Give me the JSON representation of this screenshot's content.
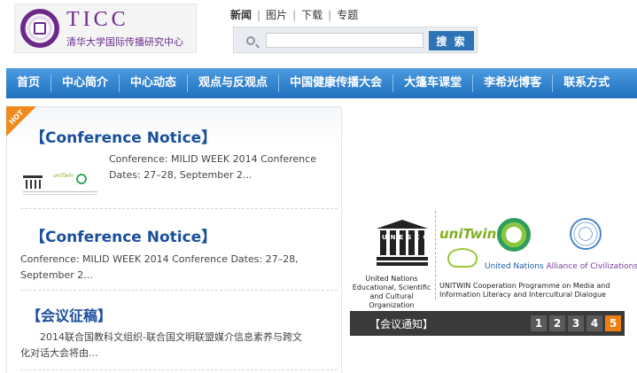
{
  "header": {
    "logo_title": "TICC",
    "logo_subtitle": "清华大学国际传播研究中心",
    "top_links": [
      "新闻",
      "图片",
      "下载",
      "专题"
    ],
    "search": {
      "value": "",
      "placeholder": "",
      "button_label": "搜 索"
    }
  },
  "nav": {
    "items": [
      "首页",
      "中心简介",
      "中心动态",
      "观点与反观点",
      "中国健康传播大会",
      "大篷车课堂",
      "李希光博客",
      "联系方式"
    ]
  },
  "hot_badge": "HOT",
  "news": [
    {
      "title": "【Conference Notice】",
      "excerpt_line1": "Conference: MILID WEEK 2014 Conference",
      "excerpt_line2": "Dates: 27–28,  September 2..."
    },
    {
      "title": "【Conference Notice】",
      "excerpt_line1": "Conference: MILID WEEK 2014 Conference Dates: 27–28,",
      "excerpt_line2": "September 2..."
    },
    {
      "title": "【会议征稿】",
      "excerpt_line1": "2014联合国教科文组织-联合国文明联盟媒介信息素养与跨文",
      "excerpt_line2": "化对话大会将由..."
    }
  ],
  "thumb": {
    "unitwin": "uniTwin"
  },
  "slider": {
    "unesco_letters": "UNESCO",
    "unesco_caption": "United Nations Educational, Scientific and Cultural Organization",
    "unitwin_logo": "uniTwin",
    "unitwin_caption": "UNITWIN Cooperation Programme on Media and Information Literacy and Intercultural Dialogue",
    "unaoc_caption_a": "United Nations",
    "unaoc_caption_b": "Alliance of Civilizations",
    "caption": "【会议通知】",
    "pages": [
      "1",
      "2",
      "3",
      "4",
      "5"
    ],
    "active_page": 5
  }
}
